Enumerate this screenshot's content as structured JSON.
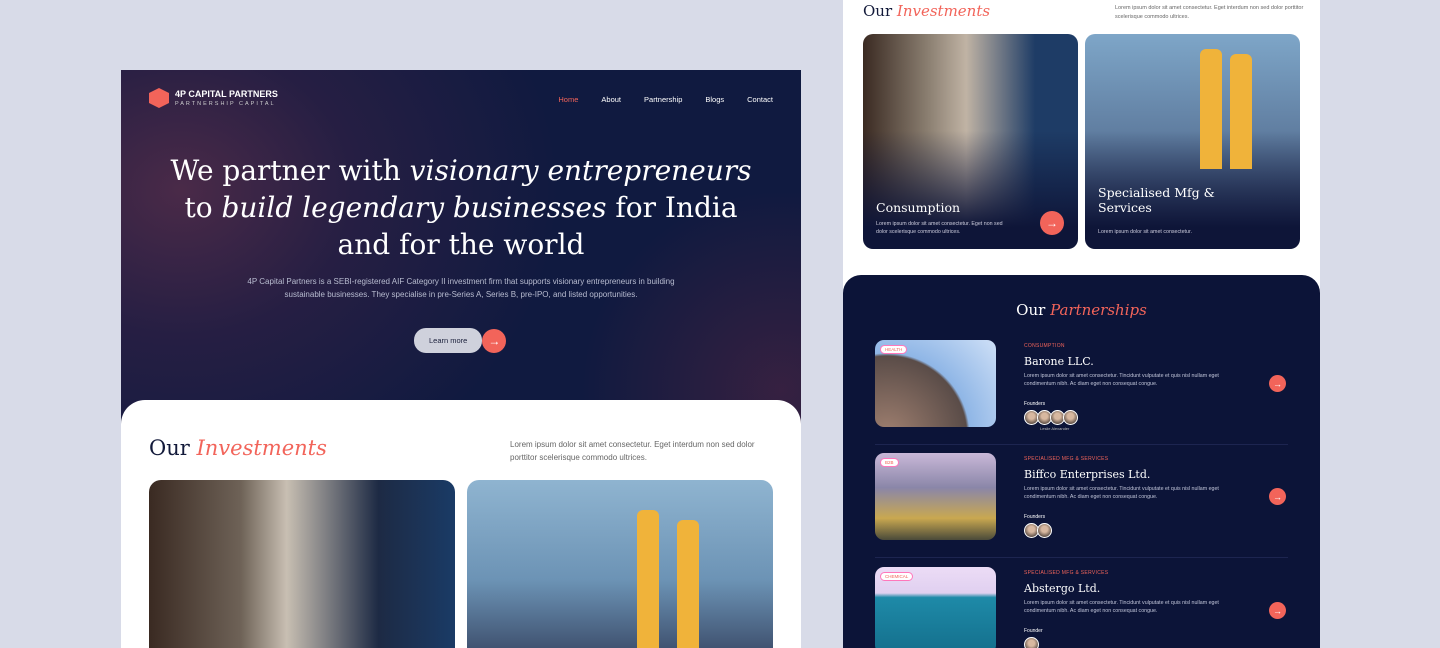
{
  "brand": {
    "name": "4P CAPITAL PARTNERS",
    "tagline": "PARTNERSHIP CAPITAL"
  },
  "nav": [
    "Home",
    "About",
    "Partnership",
    "Blogs",
    "Contact"
  ],
  "hero": {
    "line1a": "We partner with ",
    "line1b": "visionary entrepreneurs",
    "line2a": "to ",
    "line2b": "build legendary businesses",
    "line2c": " for India",
    "line3": "and for the world",
    "description": "4P Capital Partners is a SEBI-registered AIF Category II investment firm that supports visionary entrepreneurs in building sustainable businesses. They specialise in pre-Series A, Series B, pre-IPO, and listed opportunities.",
    "cta": "Learn more",
    "arrow": "→"
  },
  "investments": {
    "title_a": "Our ",
    "title_b": "Investments",
    "description": "Lorem ipsum dolor sit amet consectetur. Eget interdum non sed dolor porttitor scelerisque commodo ultrices.",
    "cards": [
      {
        "title": "Consumption",
        "text": "Lorem ipsum dolor sit amet consectetur. Eget non sed dolor scelerisque commodo ultrices."
      },
      {
        "title": "Specialised Mfg & Services",
        "text": "Lorem ipsum dolor sit amet consectetur."
      }
    ]
  },
  "partnerships": {
    "title_a": "Our ",
    "title_b": "Partnerships",
    "items": [
      {
        "badge": "HEALTH",
        "category": "CONSUMPTION",
        "name": "Barone LLC.",
        "text": "Lorem ipsum dolor sit amet consectetur. Tincidunt vulputate et quis nisl nullam eget condimentum nibh. Ac diam eget non consequat congue.",
        "founders_label": "Founders",
        "tooltip": "Leslie Alexander"
      },
      {
        "badge": "B2B",
        "category": "SPECIALISED MFG & SERVICES",
        "name": "Biffco Enterprises Ltd.",
        "text": "Lorem ipsum dolor sit amet consectetur. Tincidunt vulputate et quis nisl nullam eget condimentum nibh. Ac diam eget non consequat congue.",
        "founders_label": "Founders"
      },
      {
        "badge": "CHEMICAL",
        "category": "SPECIALISED MFG & SERVICES",
        "name": "Abstergo Ltd.",
        "text": "Lorem ipsum dolor sit amet consectetur. Tincidunt vulputate et quis nisl nullam eget condimentum nibh. Ac diam eget non consequat congue.",
        "founders_label": "Founder"
      }
    ]
  }
}
